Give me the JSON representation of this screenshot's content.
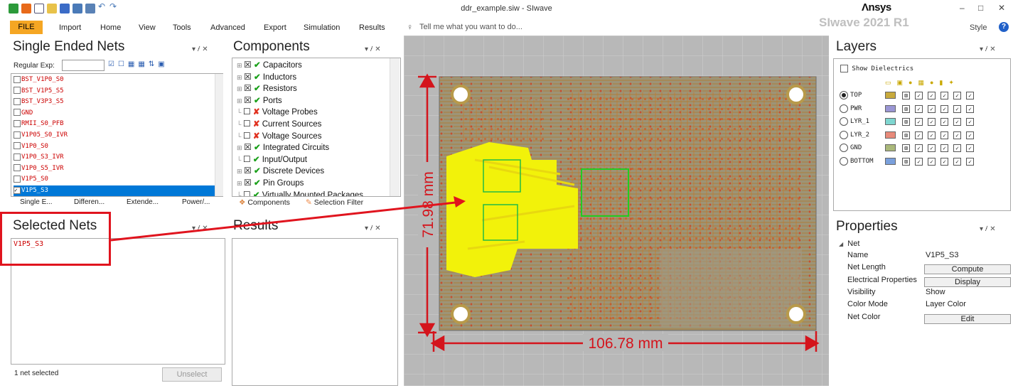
{
  "window": {
    "title": "ddr_example.siw - SIwave",
    "brand": "Λnsys",
    "watermark": "SIwave 2021 R1",
    "min": "–",
    "max": "□",
    "close": "✕"
  },
  "ribbon": {
    "file": "FILE",
    "tabs": [
      "Import",
      "Home",
      "View",
      "Tools",
      "Advanced",
      "Export",
      "Simulation",
      "Results"
    ],
    "tell": "Tell me what you want to do...",
    "style": "Style",
    "help": "?"
  },
  "single_ended": {
    "title": "Single Ended Nets",
    "regex_label": "Regular Exp:",
    "nets": [
      "BST_V1P0_S0",
      "BST_V1P5_S5",
      "BST_V3P3_S5",
      "GND",
      "RMII_S0_PFB",
      "V1P05_S0_IVR",
      "V1P0_S0",
      "V1P0_S3_IVR",
      "V1P0_S5_IVR",
      "V1P5_S0",
      "V1P5_S3"
    ],
    "selected": "V1P5_S3",
    "tabs": [
      "Single E...",
      "Differen...",
      "Extende...",
      "Power/..."
    ]
  },
  "components": {
    "title": "Components",
    "items": [
      {
        "label": "Capacitors",
        "mark": "check"
      },
      {
        "label": "Inductors",
        "mark": "check"
      },
      {
        "label": "Resistors",
        "mark": "check"
      },
      {
        "label": "Ports",
        "mark": "check"
      },
      {
        "label": "Voltage Probes",
        "mark": "x"
      },
      {
        "label": "Current Sources",
        "mark": "x"
      },
      {
        "label": "Voltage Sources",
        "mark": "x"
      },
      {
        "label": "Integrated Circuits",
        "mark": "check"
      },
      {
        "label": "Input/Output",
        "mark": "check"
      },
      {
        "label": "Discrete Devices",
        "mark": "check"
      },
      {
        "label": "Pin Groups",
        "mark": "check"
      },
      {
        "label": "Virtually Mounted Packages",
        "mark": "check"
      }
    ],
    "tabs": [
      "Components",
      "Selection Filter"
    ]
  },
  "selected_nets": {
    "title": "Selected Nets",
    "nets": [
      "V1P5_S3"
    ],
    "status": "1 net selected",
    "unselect": "Unselect"
  },
  "results": {
    "title": "Results"
  },
  "layers": {
    "title": "Layers",
    "show_dielectrics": "Show Dielectrics",
    "selected": "TOP",
    "rows": [
      {
        "name": "TOP",
        "color": "#c8aa3c"
      },
      {
        "name": "PWR",
        "color": "#9a96d4"
      },
      {
        "name": "LYR_1",
        "color": "#7fd6d0"
      },
      {
        "name": "LYR_2",
        "color": "#e88a7a"
      },
      {
        "name": "GND",
        "color": "#aab87a"
      },
      {
        "name": "BOTTOM",
        "color": "#7aa0dc"
      }
    ]
  },
  "properties": {
    "title": "Properties",
    "section": "Net",
    "rows": [
      {
        "label": "Name",
        "value": "V1P5_S3"
      },
      {
        "label": "Net Length",
        "value": "Compute"
      },
      {
        "label": "Electrical Properties",
        "value": "Display"
      },
      {
        "label": "Visibility",
        "value": "Show"
      },
      {
        "label": "Color Mode",
        "value": "Layer Color"
      },
      {
        "label": "Net Color",
        "value": "Edit"
      }
    ]
  },
  "board": {
    "width_label": "106.78 mm",
    "height_label": "71.98 mm"
  },
  "panel_ctl": "▾ ⹊ ✕",
  "colors": {
    "annotation": "#e0141e",
    "highlight": "#f2f20a",
    "selection": "#0078d7",
    "file_tab": "#f5a623"
  }
}
